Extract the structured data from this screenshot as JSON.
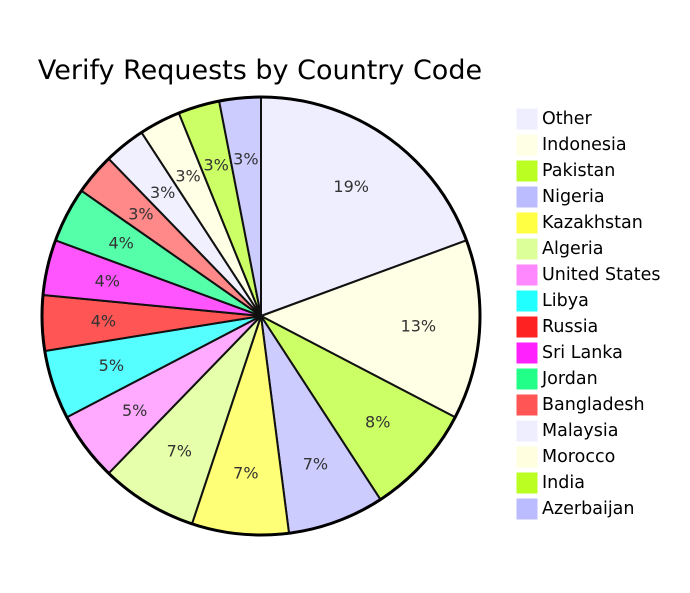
{
  "chart_data": {
    "type": "pie",
    "title": "Verify Requests by Country Code",
    "start_angle": "top",
    "direction": "clockwise",
    "legend_position": "right",
    "slices": [
      {
        "label": "Other",
        "value": 19,
        "display": "19%",
        "color": "#eeeeff",
        "legend_color": "#eeeeff"
      },
      {
        "label": "Indonesia",
        "value": 13,
        "display": "13%",
        "color": "#ffffe6",
        "legend_color": "#ffffe6"
      },
      {
        "label": "Pakistan",
        "value": 8,
        "display": "8%",
        "color": "#ccff66",
        "legend_color": "#bbff22"
      },
      {
        "label": "Nigeria",
        "value": 7,
        "display": "7%",
        "color": "#ccccff",
        "legend_color": "#bbbbff"
      },
      {
        "label": "Kazakhstan",
        "value": 7,
        "display": "7%",
        "color": "#ffff77",
        "legend_color": "#ffff44"
      },
      {
        "label": "Algeria",
        "value": 7,
        "display": "7%",
        "color": "#e6ffaa",
        "legend_color": "#ddff99"
      },
      {
        "label": "United States",
        "value": 5,
        "display": "5%",
        "color": "#ffaaff",
        "legend_color": "#ff88ff"
      },
      {
        "label": "Libya",
        "value": 5,
        "display": "5%",
        "color": "#55ffff",
        "legend_color": "#22ffff"
      },
      {
        "label": "Russia",
        "value": 4,
        "display": "4%",
        "color": "#ff5555",
        "legend_color": "#ff2222"
      },
      {
        "label": "Sri Lanka",
        "value": 4,
        "display": "4%",
        "color": "#ff55ff",
        "legend_color": "#ff22ff"
      },
      {
        "label": "Jordan",
        "value": 4,
        "display": "4%",
        "color": "#55ffaa",
        "legend_color": "#22ff88"
      },
      {
        "label": "Bangladesh",
        "value": 3,
        "display": "3%",
        "color": "#ff8888",
        "legend_color": "#ff5555"
      },
      {
        "label": "Malaysia",
        "value": 3,
        "display": "3%",
        "color": "#f0f0ff",
        "legend_color": "#eeeeff"
      },
      {
        "label": "Morocco",
        "value": 3,
        "display": "3%",
        "color": "#ffffe6",
        "legend_color": "#ffffe0"
      },
      {
        "label": "India",
        "value": 3,
        "display": "3%",
        "color": "#ccff66",
        "legend_color": "#bbff22"
      },
      {
        "label": "Azerbaijan",
        "value": 3,
        "display": "3%",
        "color": "#ccccff",
        "legend_color": "#bbbbff"
      }
    ]
  }
}
